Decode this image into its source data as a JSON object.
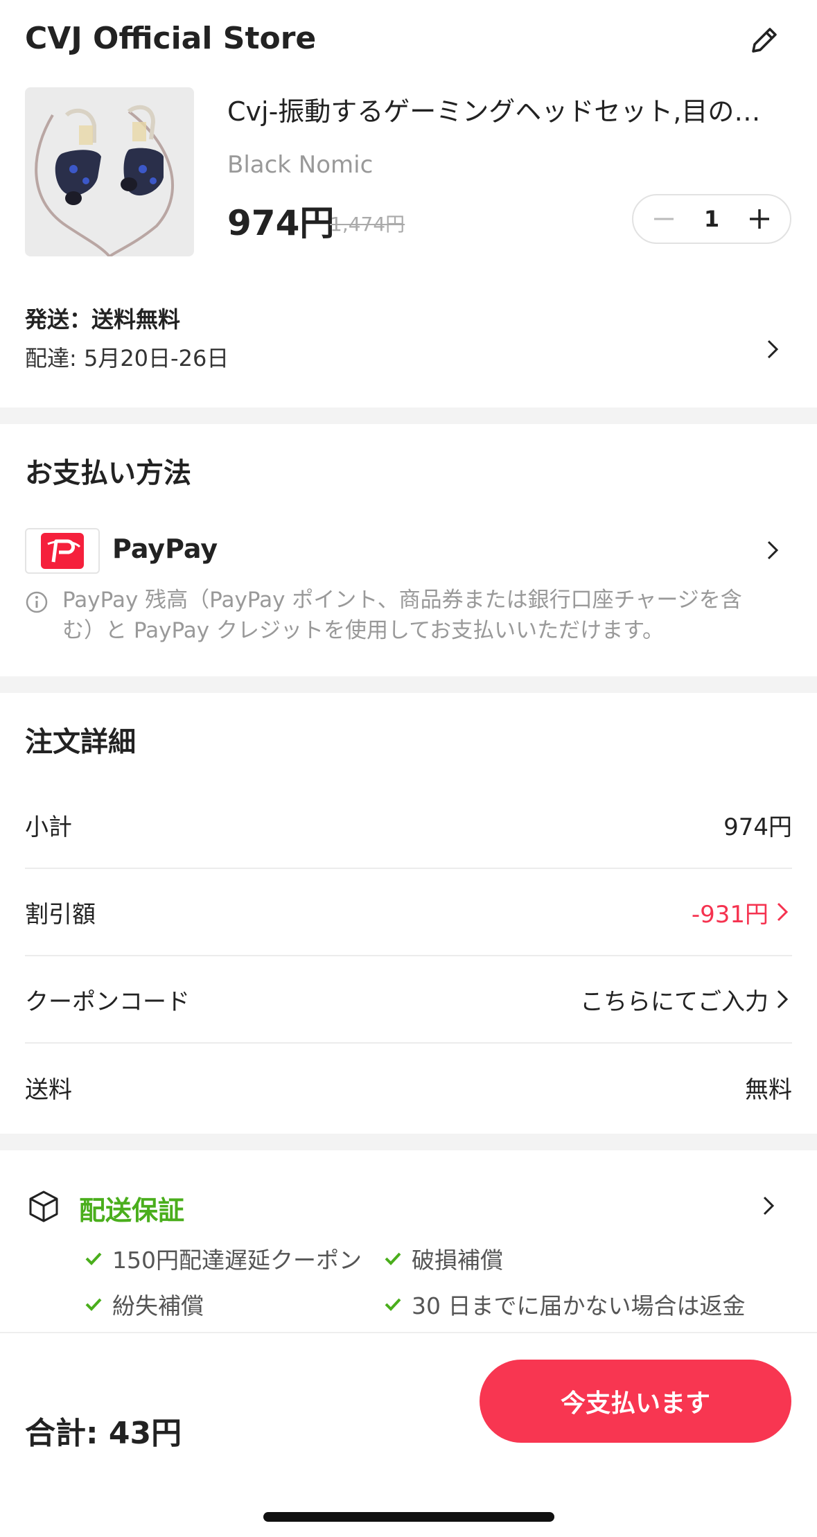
{
  "store": {
    "name": "CVJ Official Store",
    "edit_icon": "edit-pencil-icon"
  },
  "product": {
    "title": "Cvj-振動するゲーミングヘッドセット,目の…",
    "variant": "Black Nomic",
    "price": "974円",
    "original_price": "1,474円",
    "quantity": "1",
    "image_icon": "earphones-image"
  },
  "shipping": {
    "title": "発送：送料無料",
    "delivery": "配達: 5月20日-26日"
  },
  "payment": {
    "section_title": "お支払い方法",
    "method_name": "PayPay",
    "note": "PayPay 残高（PayPay ポイント、商品券または銀行口座チャージを含む）と PayPay クレジットを使用してお支払いいただけます。"
  },
  "order": {
    "section_title": "注文詳細",
    "rows": [
      {
        "label": "小計",
        "value": "974円"
      },
      {
        "label": "割引額",
        "value": "-931円"
      },
      {
        "label": "クーポンコード",
        "value": "こちらにてご入力"
      },
      {
        "label": "送料",
        "value": "無料"
      }
    ]
  },
  "guarantee": {
    "title": "配送保証",
    "items": [
      "150円配達遅延クーポン",
      "破損補償",
      "紛失補償",
      "30 日までに届かない場合は返金"
    ]
  },
  "footer": {
    "total": "合計: 43円",
    "pay_button": "今支払います"
  },
  "colors": {
    "accent": "#f83651",
    "discount": "#f5324f",
    "guarantee": "#4aae1c",
    "paypay": "#f5203c"
  }
}
